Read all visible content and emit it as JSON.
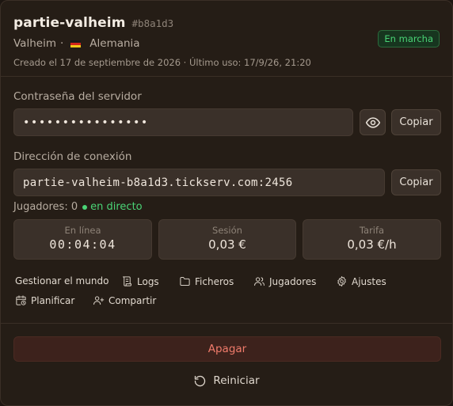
{
  "server": {
    "name": "partie-valheim",
    "id": "#b8a1d3",
    "game": "Valheim",
    "separator": "·",
    "region": "Alemania",
    "created": "Creado el 17 de septiembre de 2026 · Último uso: 17/9/26, 21:20",
    "status": "En marcha"
  },
  "password": {
    "label": "Contraseña del servidor",
    "masked": "••••••••••••••••",
    "copy_label": "Copiar"
  },
  "address": {
    "label": "Dirección de conexión",
    "value": "partie-valheim-b8a1d3.tickserv.com:2456",
    "copy_label": "Copiar"
  },
  "players": {
    "label": "Jugadores: 0",
    "live": "en directo"
  },
  "stats": [
    {
      "label": "En línea",
      "value": "00:04:04"
    },
    {
      "label": "Sesión",
      "value": "0,03 €"
    },
    {
      "label": "Tarifa",
      "value": "0,03 €/h"
    }
  ],
  "actions": {
    "manage": "Gestionar el mundo",
    "logs": "Logs",
    "files": "Ficheros",
    "players": "Jugadores",
    "settings": "Ajustes",
    "schedule": "Planificar",
    "share": "Compartir"
  },
  "buttons": {
    "stop": "Apagar",
    "restart": "Reiniciar"
  },
  "colors": {
    "background": "#251d16",
    "field": "#3a3029",
    "accent_green": "#4ad476",
    "danger": "#f07b6b"
  }
}
